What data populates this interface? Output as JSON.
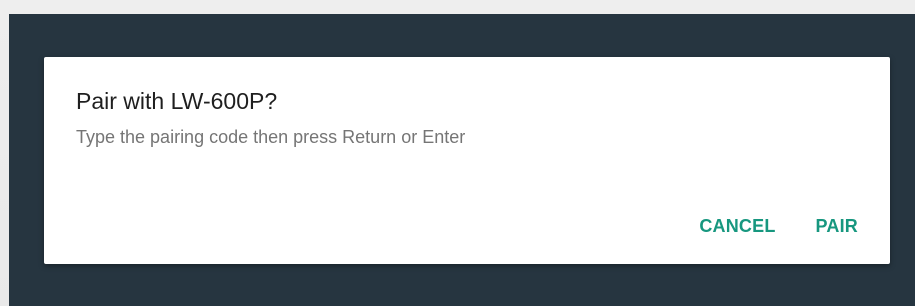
{
  "dialog": {
    "title": "Pair with LW-600P?",
    "message": "Type the pairing code then press Return or Enter",
    "cancel_label": "CANCEL",
    "pair_label": "PAIR"
  },
  "colors": {
    "overlay": "#263540",
    "accent": "#17977f",
    "title_text": "#1f1f1f",
    "message_text": "#757575",
    "dialog_background": "#ffffff"
  }
}
